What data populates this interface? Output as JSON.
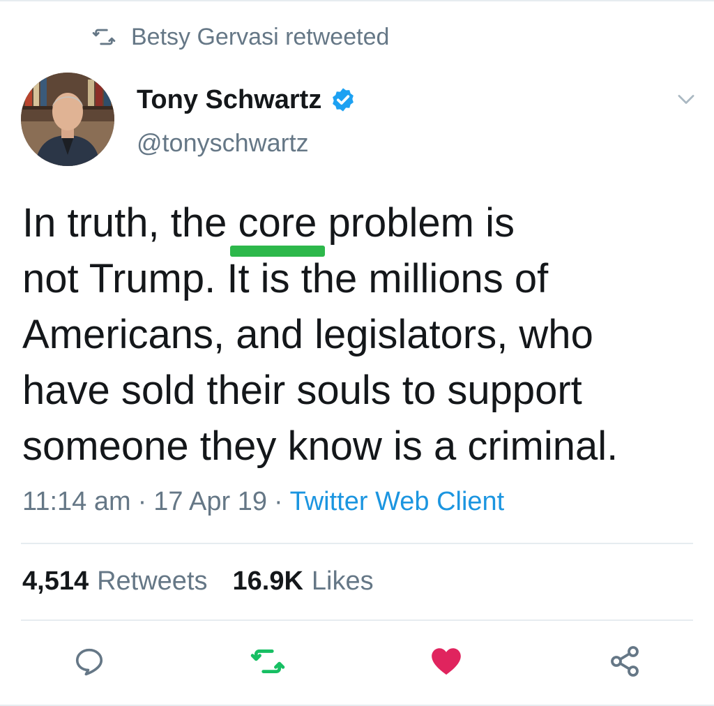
{
  "retweet_context": {
    "label": "Betsy Gervasi retweeted",
    "icon": "retweet-icon"
  },
  "author": {
    "name": "Tony Schwartz",
    "handle": "@tonyschwartz",
    "verified": true,
    "avatar_icon": "avatar-photo"
  },
  "tweet": {
    "lines": [
      {
        "before": "In truth, the ",
        "highlight": "core",
        "after": " problem is"
      },
      "not Trump. It is the millions of",
      "Americans, and legislators, who",
      "have sold their souls to support",
      "someone they know is a criminal."
    ],
    "highlight_color": "#2db84b"
  },
  "meta": {
    "time": "11:14 am",
    "separator": "·",
    "date": "17 Apr 19",
    "source": "Twitter Web Client"
  },
  "stats": {
    "retweets_count": "4,514",
    "retweets_label": "Retweets",
    "likes_count": "16.9K",
    "likes_label": "Likes"
  },
  "actions": [
    {
      "name": "reply",
      "icon": "reply-icon"
    },
    {
      "name": "retweet",
      "icon": "retweet-icon"
    },
    {
      "name": "like",
      "icon": "heart-icon"
    },
    {
      "name": "share",
      "icon": "share-icon"
    }
  ],
  "colors": {
    "text": "#14171a",
    "muted": "#657786",
    "link": "#1b95e0",
    "verified": "#1da1f2",
    "retweet_active": "#17bf63",
    "like_active": "#e0245e",
    "divider": "#e6ecf0"
  }
}
